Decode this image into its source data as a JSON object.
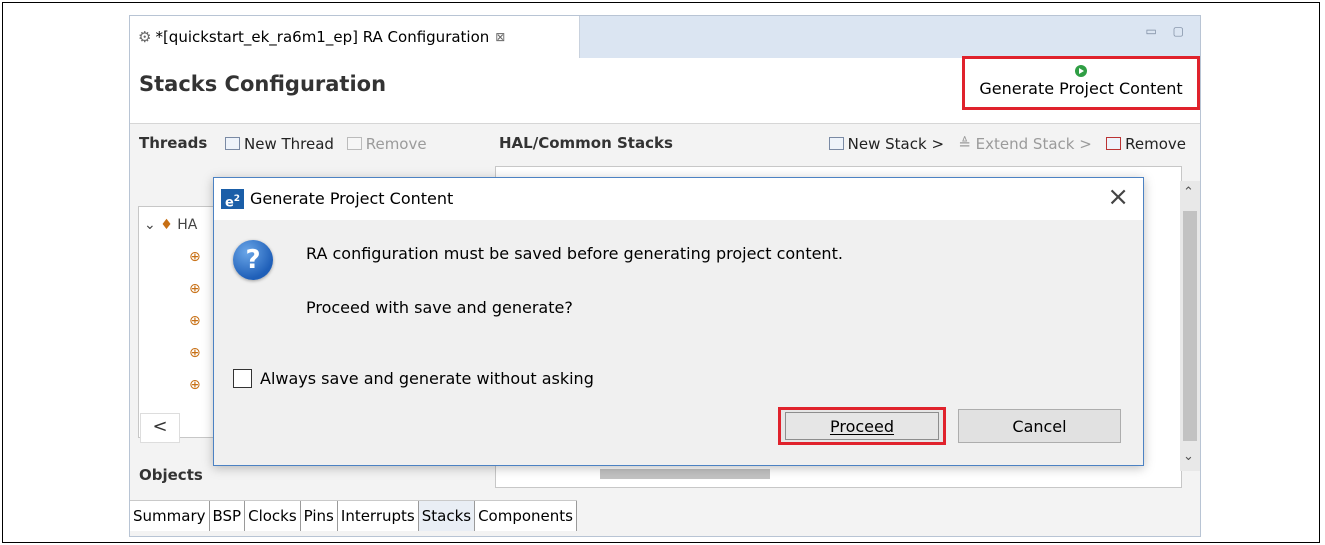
{
  "editor": {
    "tab_title": "*[quickstart_ek_ra6m1_ep] RA Configuration",
    "tab_close": "⊠",
    "win_controls": "▭ ▢"
  },
  "header": {
    "title": "Stacks Configuration",
    "generate_label": "Generate Project Content"
  },
  "threads": {
    "heading": "Threads",
    "new_thread": "New Thread",
    "remove": "Remove",
    "tree_root": "HA",
    "objects_heading": "Objects",
    "scroll_left": "<"
  },
  "hal": {
    "heading": "HAL/Common Stacks",
    "new_stack": "New Stack >",
    "extend_stack": "Extend Stack >",
    "remove": "Remove"
  },
  "bottom_tabs": [
    "Summary",
    "BSP",
    "Clocks",
    "Pins",
    "Interrupts",
    "Stacks",
    "Components"
  ],
  "dialog": {
    "title": "Generate Project Content",
    "message": "RA configuration must be saved before generating project content.",
    "question": "Proceed with save and generate?",
    "checkbox_label": "Always save and generate without asking",
    "proceed": "Proceed",
    "cancel": "Cancel",
    "close_glyph": "×",
    "logo_text": "e",
    "logo_sup": "2"
  },
  "colors": {
    "highlight": "#e0222c",
    "dialog_border": "#4c82c3"
  }
}
